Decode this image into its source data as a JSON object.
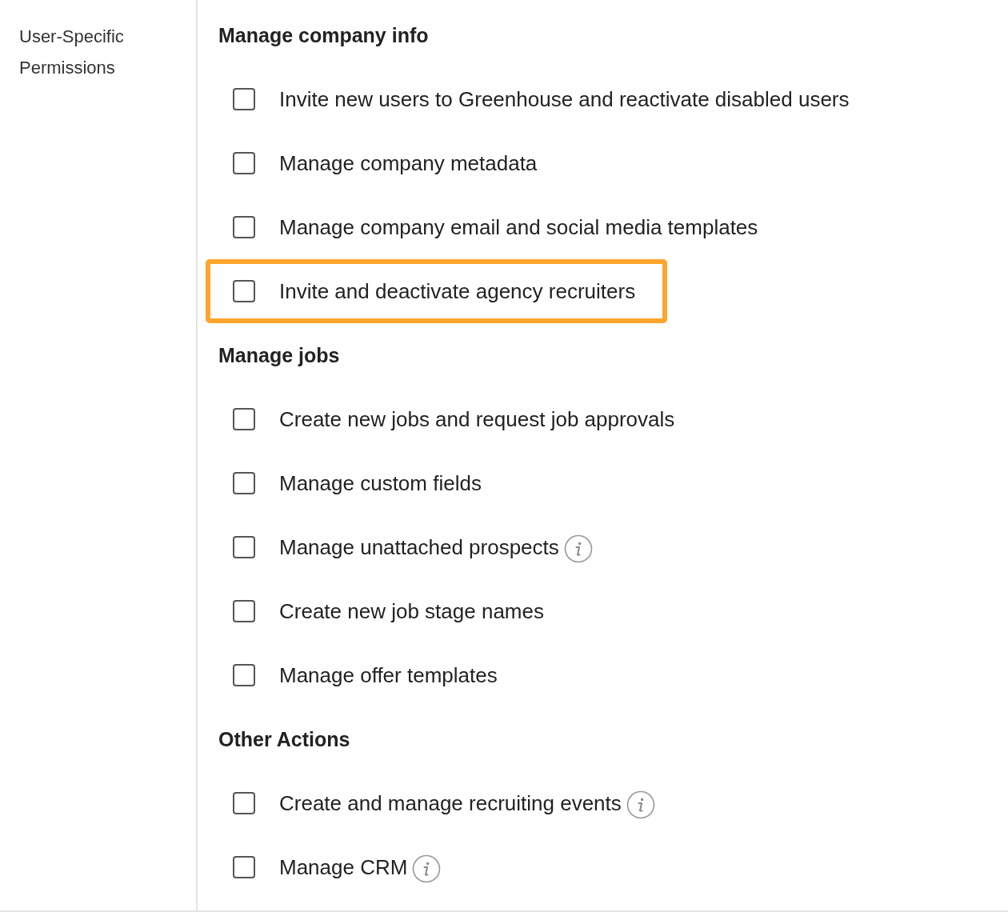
{
  "sidebar": {
    "label": "User-Specific Permissions"
  },
  "sections": [
    {
      "title": "Manage company info",
      "items": [
        {
          "label": "Invite new users to Greenhouse and reactivate disabled users",
          "checked": false,
          "info": false,
          "highlighted": false
        },
        {
          "label": "Manage company metadata",
          "checked": false,
          "info": false,
          "highlighted": false
        },
        {
          "label": "Manage company email and social media templates",
          "checked": false,
          "info": false,
          "highlighted": false
        },
        {
          "label": "Invite and deactivate agency recruiters",
          "checked": false,
          "info": false,
          "highlighted": true
        }
      ]
    },
    {
      "title": "Manage jobs",
      "items": [
        {
          "label": "Create new jobs and request job approvals",
          "checked": false,
          "info": false,
          "highlighted": false
        },
        {
          "label": "Manage custom fields",
          "checked": false,
          "info": false,
          "highlighted": false
        },
        {
          "label": "Manage unattached prospects",
          "checked": false,
          "info": true,
          "highlighted": false
        },
        {
          "label": "Create new job stage names",
          "checked": false,
          "info": false,
          "highlighted": false
        },
        {
          "label": "Manage offer templates",
          "checked": false,
          "info": false,
          "highlighted": false
        }
      ]
    },
    {
      "title": "Other Actions",
      "items": [
        {
          "label": "Create and manage recruiting events",
          "checked": false,
          "info": true,
          "highlighted": false
        },
        {
          "label": "Manage CRM",
          "checked": false,
          "info": true,
          "highlighted": false
        }
      ]
    }
  ]
}
